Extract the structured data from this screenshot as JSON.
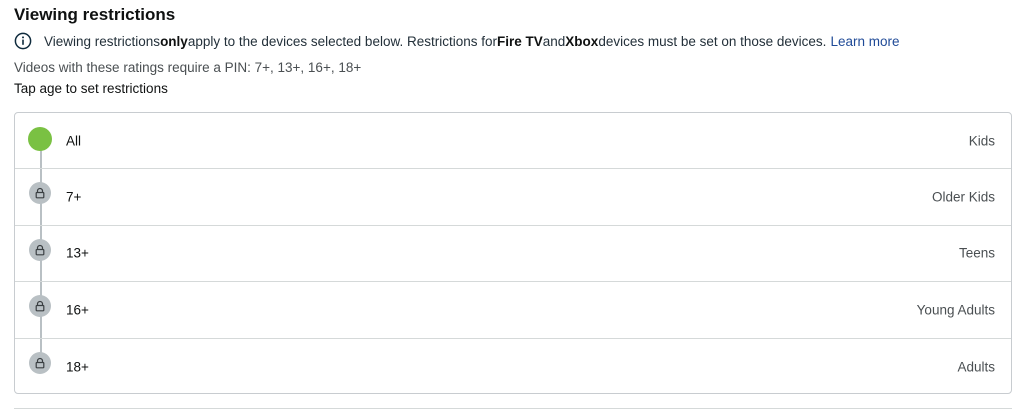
{
  "title": "Viewing restrictions",
  "info": {
    "part1": "Viewing restrictions ",
    "emphasis_only": "only",
    "part2": " apply to the devices selected below. Restrictions for ",
    "device1": "Fire TV",
    "part3": " and ",
    "device2": "Xbox",
    "part4": " devices must be set on those devices.",
    "learn_more": "Learn more"
  },
  "pin_note": "Videos with these ratings require a PIN: 7+, 13+, 16+, 18+",
  "tap_note": "Tap age to set restrictions",
  "ratings": [
    {
      "age": "All",
      "group": "Kids",
      "state": "selected"
    },
    {
      "age": "7+",
      "group": "Older Kids",
      "state": "locked"
    },
    {
      "age": "13+",
      "group": "Teens",
      "state": "locked"
    },
    {
      "age": "16+",
      "group": "Young Adults",
      "state": "locked"
    },
    {
      "age": "18+",
      "group": "Adults",
      "state": "locked"
    }
  ],
  "colors": {
    "selected_marker": "#7ac143",
    "locked_marker": "#b9c0c4",
    "link": "#1f4a97"
  },
  "icons": {
    "info": "info-circle-icon",
    "lock": "lock-icon"
  }
}
